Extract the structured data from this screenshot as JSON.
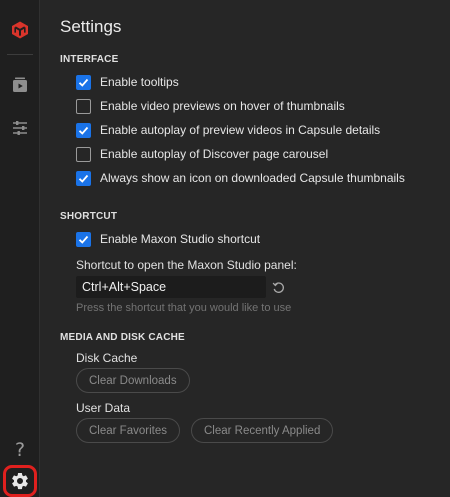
{
  "sidebar": {
    "items": [
      {
        "name": "maxon-logo",
        "icon": "maxon-cube-icon"
      },
      {
        "name": "capsules",
        "icon": "play-stack-icon"
      },
      {
        "name": "filters",
        "icon": "sliders-icon"
      }
    ],
    "help": {
      "icon": "help-icon",
      "glyph": "?"
    },
    "settings": {
      "icon": "gear-icon",
      "highlight_color": "#e0201e"
    }
  },
  "page": {
    "title": "Settings"
  },
  "interface": {
    "heading": "INTERFACE",
    "options": [
      {
        "label": "Enable tooltips",
        "checked": true
      },
      {
        "label": "Enable video previews on hover of thumbnails",
        "checked": false
      },
      {
        "label": "Enable autoplay of preview videos in Capsule details",
        "checked": true
      },
      {
        "label": "Enable autoplay of Discover page carousel",
        "checked": false
      },
      {
        "label": "Always show an icon on downloaded Capsule thumbnails",
        "checked": true
      }
    ]
  },
  "shortcut": {
    "heading": "SHORTCUT",
    "enable": {
      "label": "Enable Maxon Studio shortcut",
      "checked": true
    },
    "field_label": "Shortcut to open the Maxon Studio panel:",
    "value": "Ctrl+Alt+Space",
    "hint": "Press the shortcut that you would like to use",
    "reset_icon": "reset-icon"
  },
  "cache": {
    "heading": "MEDIA AND DISK CACHE",
    "disk_label": "Disk Cache",
    "clear_downloads": "Clear Downloads",
    "user_data_label": "User Data",
    "clear_favorites": "Clear Favorites",
    "clear_recently_applied": "Clear Recently Applied"
  },
  "colors": {
    "accent": "#1a73e8",
    "brand": "#e0201e",
    "background": "#262626"
  }
}
